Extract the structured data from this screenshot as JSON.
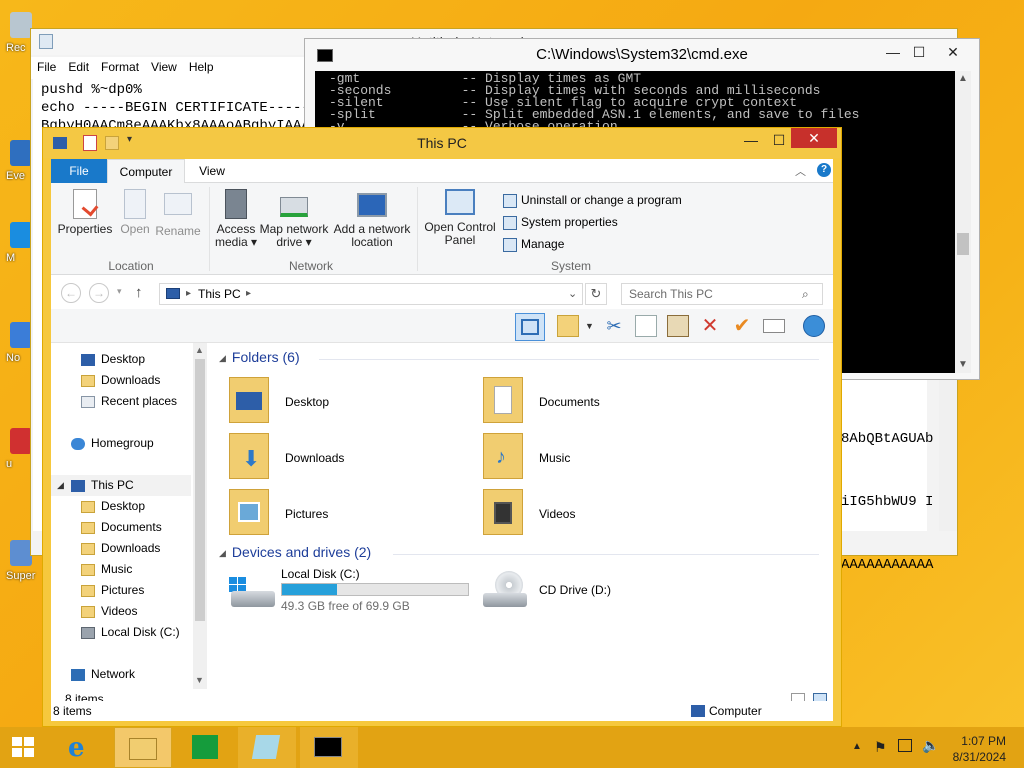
{
  "desktop": {
    "icons": [
      {
        "label": "Rec",
        "color": "#b8c6d0"
      },
      {
        "label": "Eve",
        "color": "#2f6fbf"
      },
      {
        "label": "M",
        "color": "#1a8de0"
      },
      {
        "label": "No",
        "color": "#3b7dd8"
      },
      {
        "label": "u",
        "color": "#d03030"
      },
      {
        "label": "Super",
        "color": "#5d8ed1"
      }
    ]
  },
  "notepad": {
    "title": "Untitled - Notepad",
    "menu": [
      "File",
      "Edit",
      "Format",
      "View",
      "Help"
    ],
    "lines": [
      "pushd %~dp0%",
      "echo -----BEGIN CERTIFICATE-----",
      "BgbyH0AACm8eAAAKbx8AAAoABgbyIAAAC"
    ],
    "right_fragments": [
      "8AbQBtAGUAb",
      "iIG5hbWU9 I",
      "AAAAAAAAAAA"
    ]
  },
  "cmd": {
    "title": "C:\\Windows\\System32\\cmd.exe",
    "lines": [
      "-gmt             -- Display times as GMT",
      "-seconds         -- Display times with seconds and milliseconds",
      "-silent          -- Use silent flag to acquire crypt context",
      "-split           -- Split embedded ASN.1 elements, and save to files",
      "-v               -- Verbose operation"
    ]
  },
  "explorer": {
    "title": "This PC",
    "tabs": {
      "file": "File",
      "computer": "Computer",
      "view": "View"
    },
    "ribbon": {
      "location": {
        "label": "Location",
        "properties": "Properties",
        "open": "Open",
        "rename": "Rename"
      },
      "network": {
        "label": "Network",
        "access_media_1": "Access",
        "access_media_2": "media ▾",
        "map_drive_1": "Map network",
        "map_drive_2": "drive ▾",
        "add_location_1": "Add a network",
        "add_location_2": "location"
      },
      "system": {
        "label": "System",
        "open_cp_1": "Open Control",
        "open_cp_2": "Panel",
        "uninstall": "Uninstall or change a program",
        "sys_props": "System properties",
        "manage": "Manage"
      }
    },
    "address": {
      "path": "This PC",
      "search_placeholder": "Search This PC"
    },
    "nav": {
      "desktop": "Desktop",
      "downloads": "Downloads",
      "recent": "Recent places",
      "homegroup": "Homegroup",
      "thispc": "This PC",
      "pc_desktop": "Desktop",
      "pc_documents": "Documents",
      "pc_downloads": "Downloads",
      "pc_music": "Music",
      "pc_pictures": "Pictures",
      "pc_videos": "Videos",
      "pc_localdisk": "Local Disk (C:)",
      "network": "Network"
    },
    "folders_header": "Folders (6)",
    "folders": [
      "Desktop",
      "Documents",
      "Downloads",
      "Music",
      "Pictures",
      "Videos"
    ],
    "devices_header": "Devices and drives (2)",
    "drive_c": {
      "name": "Local Disk (C:)",
      "free": "49.3 GB free of 69.9 GB",
      "used_fraction": 0.295
    },
    "drive_d": {
      "name": "CD Drive (D:)"
    },
    "status_items": "8 items",
    "outer_status_items": "8 items",
    "outer_status_computer": "Computer"
  },
  "taskbar": {
    "time": "1:07 PM",
    "date": "8/31/2024"
  },
  "colors": {
    "accent": "#1979ca",
    "wallpaper": "#f5a912",
    "drive_bar": "#26a0da"
  }
}
